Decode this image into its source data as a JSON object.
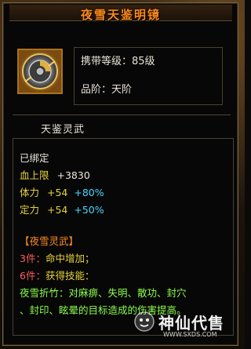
{
  "title": "夜雪天鉴明镜",
  "item": {
    "icon_name": "mirror-disc-icon",
    "carry_level": "携带等级：85级",
    "rarity": "品阶：天阶"
  },
  "section": {
    "name": "天鉴灵武"
  },
  "stats": {
    "bound": "已绑定",
    "hp_label": "血上限",
    "hp_value": "+3830",
    "con_label": "体力",
    "con_value": "+54",
    "con_bonus": "+80%",
    "dex_label": "定力",
    "dex_value": "+54",
    "dex_bonus": "+50%"
  },
  "set": {
    "name": "【夜雪灵武】",
    "piece3_label": "3件：",
    "piece3_text": "命中增加；",
    "piece6_label": "6件：",
    "piece6_text": "获得技能：",
    "skill_line1": "夜雪折竹：对麻痹、失明、散功、封穴",
    "skill_line2": "、封印、眩晕的目标造成的伤害提高。"
  },
  "watermark": {
    "brand": "神仙代售",
    "url": "WWW.SXDS.COM"
  },
  "colors": {
    "title": "#ff8a1c",
    "border": "#7a6640",
    "stat_yellow": "#e6d23c",
    "bonus_cyan": "#48d8ff",
    "set_orange": "#ff8a26",
    "piece_red": "#ff5d5d",
    "skill_green": "#8cff4a"
  }
}
